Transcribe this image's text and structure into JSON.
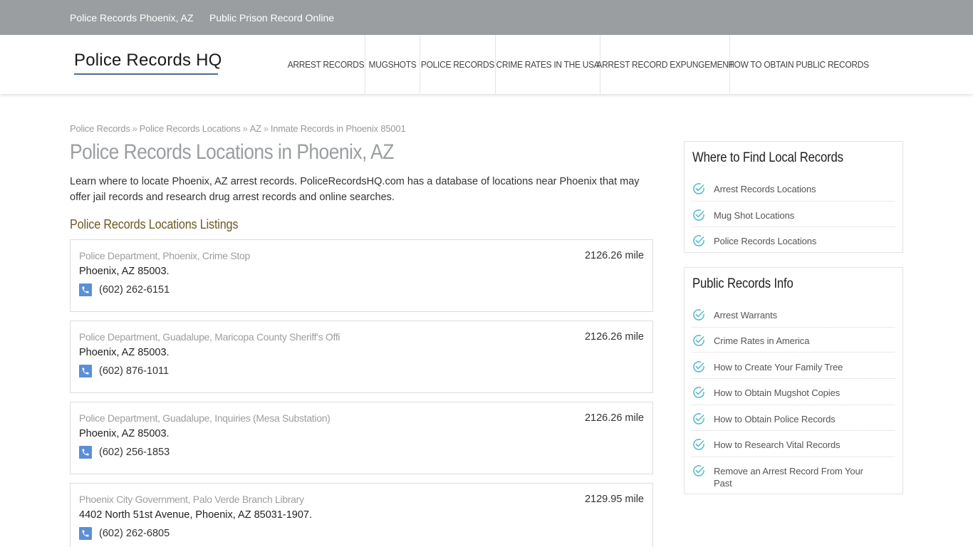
{
  "topbar": {
    "links": [
      "Police Records Phoenix, AZ",
      "Public Prison Record Online"
    ]
  },
  "header": {
    "logo": "Police Records HQ",
    "nav": [
      "ARREST RECORDS",
      "MUGSHOTS",
      "POLICE RECORDS",
      "CRIME RATES IN THE USA",
      "ARREST RECORD EXPUNGEMENT",
      "HOW TO OBTAIN PUBLIC RECORDS"
    ]
  },
  "breadcrumb": {
    "items": [
      "Police Records",
      "Police Records Locations",
      "AZ",
      "Inmate Records in Phoenix 85001"
    ],
    "separator": "»"
  },
  "main": {
    "title": "Police Records Locations in Phoenix, AZ",
    "intro": "Learn where to locate Phoenix, AZ arrest records. PoliceRecordsHQ.com has a database of locations near Phoenix that may offer jail records and research drug arrest records and online searches.",
    "listings_heading": "Police Records Locations Listings",
    "listings": [
      {
        "name": "Police Department, Phoenix, Crime Stop",
        "distance": "2126.26 mile",
        "address": "Phoenix, AZ 85003.",
        "phone": "(602) 262-6151"
      },
      {
        "name": "Police Department, Guadalupe, Maricopa County Sheriff's Offi",
        "distance": "2126.26 mile",
        "address": "Phoenix, AZ 85003.",
        "phone": "(602) 876-1011"
      },
      {
        "name": "Police Department, Guadalupe, Inquiries (Mesa Substation)",
        "distance": "2126.26 mile",
        "address": "Phoenix, AZ 85003.",
        "phone": "(602) 256-1853"
      },
      {
        "name": "Phoenix City Government, Palo Verde Branch Library",
        "distance": "2129.95 mile",
        "address": "4402 North 51st Avenue, Phoenix, AZ 85031-1907.",
        "phone": "(602) 262-6805"
      }
    ]
  },
  "sidebar": {
    "widgets": [
      {
        "title": "Where to Find Local Records",
        "items": [
          "Arrest Records Locations",
          "Mug Shot Locations",
          "Police Records Locations"
        ]
      },
      {
        "title": "Public Records Info",
        "items": [
          "Arrest Warrants",
          "Crime Rates in America",
          "How to Create Your Family Tree",
          "How to Obtain Mugshot Copies",
          "How to Obtain Police Records",
          "How to Research Vital Records",
          "Remove an Arrest Record From Your Past"
        ]
      }
    ]
  },
  "colors": {
    "topbar_bg": "#9b9ea0",
    "accent_heading": "#6b5a22",
    "phone_icon": "#5b8fd6",
    "check_icon": "#4fb8c9"
  },
  "icons": {
    "phone": "phone-icon",
    "check": "check-circle-icon"
  }
}
